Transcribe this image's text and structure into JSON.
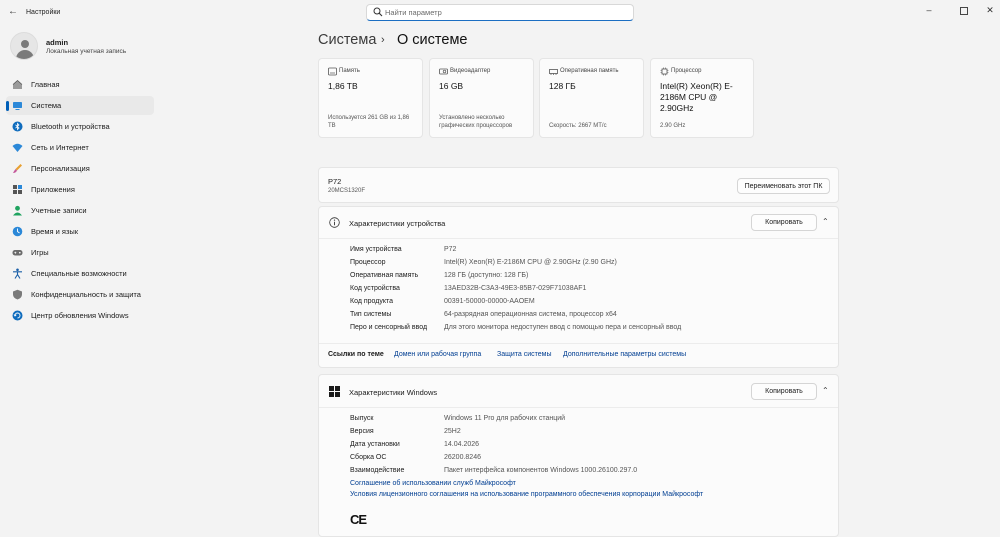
{
  "app": {
    "title": "Настройки",
    "search_placeholder": "Найти параметр"
  },
  "user": {
    "name": "admin",
    "account_type": "Локальная учетная запись"
  },
  "sidebar": {
    "items": [
      {
        "label": "Главная",
        "icon": "home-icon",
        "active": false
      },
      {
        "label": "Система",
        "icon": "system-icon",
        "active": true
      },
      {
        "label": "Bluetooth и устройства",
        "icon": "bluetooth-icon",
        "active": false
      },
      {
        "label": "Сеть и Интернет",
        "icon": "network-icon",
        "active": false
      },
      {
        "label": "Персонализация",
        "icon": "personalization-icon",
        "active": false
      },
      {
        "label": "Приложения",
        "icon": "apps-icon",
        "active": false
      },
      {
        "label": "Учетные записи",
        "icon": "accounts-icon",
        "active": false
      },
      {
        "label": "Время и язык",
        "icon": "time-language-icon",
        "active": false
      },
      {
        "label": "Игры",
        "icon": "gaming-icon",
        "active": false
      },
      {
        "label": "Специальные возможности",
        "icon": "accessibility-icon",
        "active": false
      },
      {
        "label": "Конфиденциальность и защита",
        "icon": "privacy-shield-icon",
        "active": false
      },
      {
        "label": "Центр обновления Windows",
        "icon": "windows-update-icon",
        "active": false
      }
    ]
  },
  "header": {
    "breadcrumb_parent": "Система",
    "breadcrumb_separator": "›",
    "title": "О системе"
  },
  "tiles": [
    {
      "label": "Память",
      "value": "1,86 TB",
      "sub": "Используется 261 GB из 1,86 TB",
      "icon": "storage-icon"
    },
    {
      "label": "Видеоадаптер",
      "value": "16 GB",
      "sub": "Установлено несколько графических процессоров",
      "icon": "gpu-icon"
    },
    {
      "label": "Оперативная память",
      "value": "128 ГБ",
      "sub": "Скорость: 2667 MT/c",
      "icon": "ram-icon"
    },
    {
      "label": "Процессор",
      "value": "Intel(R) Xeon(R) E-2186M  CPU @ 2.90GHz",
      "sub": "2.90 GHz",
      "icon": "cpu-icon"
    }
  ],
  "pc": {
    "name": "P72",
    "model": "20MCS1320F",
    "rename_label": "Переименовать этот ПК"
  },
  "device_specs": {
    "title": "Характеристики устройства",
    "copy_label": "Копировать",
    "rows": [
      {
        "key": "Имя устройства",
        "value": "P72"
      },
      {
        "key": "Процессор",
        "value": "Intel(R) Xeon(R) E-2186M  CPU @ 2.90GHz (2.90 GHz)"
      },
      {
        "key": "Оперативная память",
        "value": "128 ГБ (доступно: 128 ГБ)"
      },
      {
        "key": "Код устройства",
        "value": "13AED32B-C3A3-49E3-85B7-029F71038AF1"
      },
      {
        "key": "Код продукта",
        "value": "00391-50000-00000-AAOEM"
      },
      {
        "key": "Тип системы",
        "value": "64-разрядная операционная система, процессор x64"
      },
      {
        "key": "Перо и сенсорный ввод",
        "value": "Для этого монитора недоступен ввод с помощью пера и сенсорный ввод"
      }
    ]
  },
  "related": {
    "label": "Ссылки по теме",
    "links": [
      "Домен или рабочая группа",
      "Защита системы",
      "Дополнительные параметры системы"
    ]
  },
  "windows_specs": {
    "title": "Характеристики Windows",
    "copy_label": "Копировать",
    "rows": [
      {
        "key": "Выпуск",
        "value": "Windows 11 Pro для рабочих станций"
      },
      {
        "key": "Версия",
        "value": "25H2"
      },
      {
        "key": "Дата установки",
        "value": "14.04.2026"
      },
      {
        "key": "Сборка ОС",
        "value": "26200.8246"
      },
      {
        "key": "Взаимодействие",
        "value": "Пакет интерфейса компонентов Windows 1000.26100.297.0"
      }
    ],
    "links": [
      "Соглашение об использовании служб Майкрософт",
      "Условия лицензионного соглашения на использование программного обеспечения корпорации Майкрософт"
    ],
    "ce_mark": "CE"
  },
  "colors": {
    "accent": "#005fb8",
    "link": "#003e92",
    "background": "#f3f3f3"
  }
}
